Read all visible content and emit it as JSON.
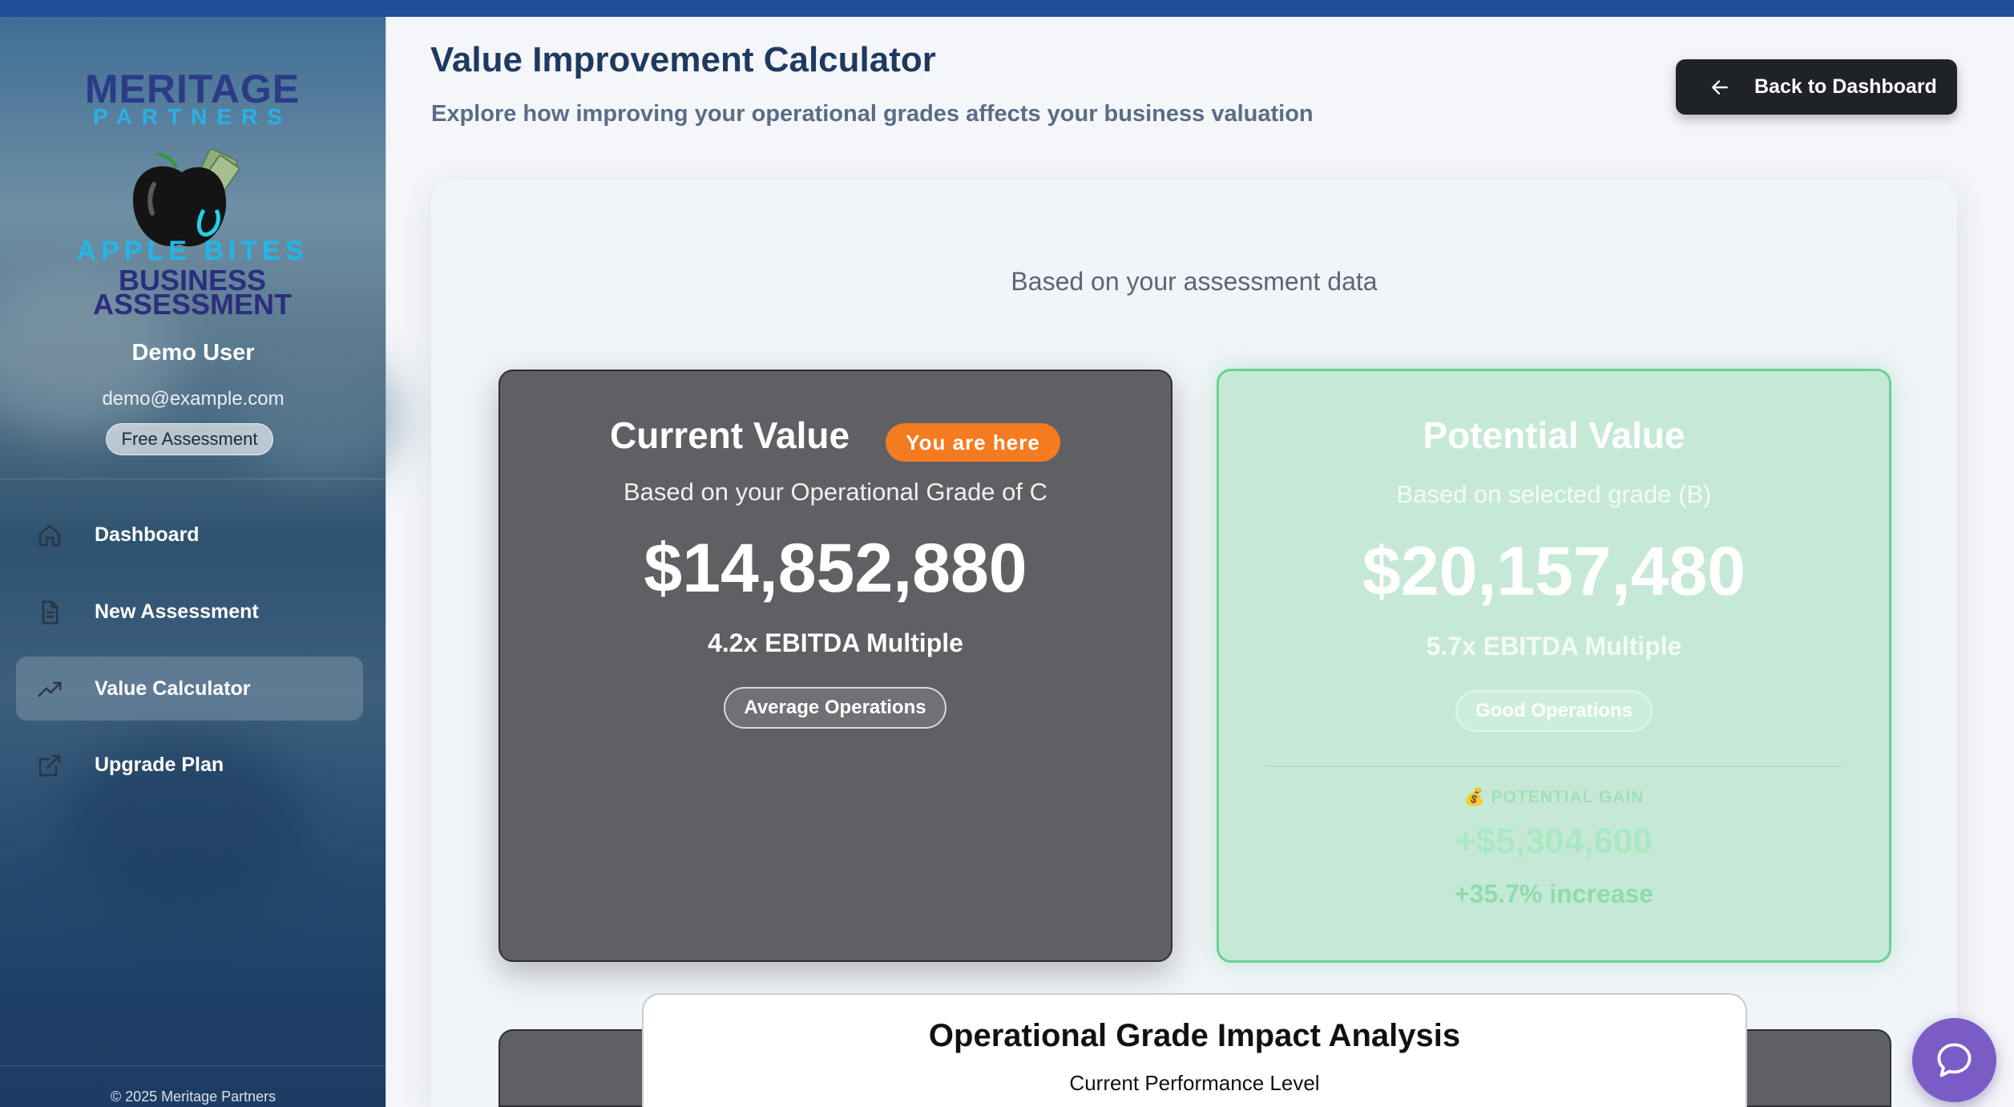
{
  "brand": {
    "line1": "MERITAGE",
    "line2": "PARTNERS",
    "line3": "APPLE BITES",
    "line4": "BUSINESS",
    "line5": "ASSESSMENT"
  },
  "user": {
    "name": "Demo User",
    "email": "demo@example.com",
    "plan": "Free Assessment"
  },
  "nav": {
    "items": [
      {
        "label": "Dashboard",
        "icon": "home-icon"
      },
      {
        "label": "New Assessment",
        "icon": "document-icon"
      },
      {
        "label": "Value Calculator",
        "icon": "trending-up-icon",
        "active": true
      },
      {
        "label": "Upgrade Plan",
        "icon": "external-link-icon"
      }
    ]
  },
  "footer": {
    "copyright": "© 2025 Meritage Partners"
  },
  "header": {
    "title": "Value Improvement Calculator",
    "subtitle": "Explore how improving your operational grades affects your business valuation",
    "back_label": "Back to Dashboard"
  },
  "panel": {
    "basis_note": "Based on your assessment data"
  },
  "current": {
    "title": "Current Value",
    "badge": "You are here",
    "basis": "Based on your Operational Grade of C",
    "value": "$14,852,880",
    "multiple": "4.2x EBITDA Multiple",
    "chip": "Average Operations"
  },
  "potential": {
    "title": "Potential Value",
    "basis": "Based on selected grade (B)",
    "value": "$20,157,480",
    "multiple": "5.7x EBITDA Multiple",
    "chip": "Good Operations",
    "gain_label": "💰 POTENTIAL GAIN",
    "gain_value": "+$5,304,600",
    "gain_pct": "+35.7% increase"
  },
  "impact": {
    "title": "Operational Grade Impact Analysis",
    "subtitle": "Current Performance Level"
  },
  "colors": {
    "accent_orange": "#f47b20",
    "success_green": "#6ccf93",
    "chat_purple": "#7b5cc7",
    "brand_blue": "#1e4f97"
  }
}
